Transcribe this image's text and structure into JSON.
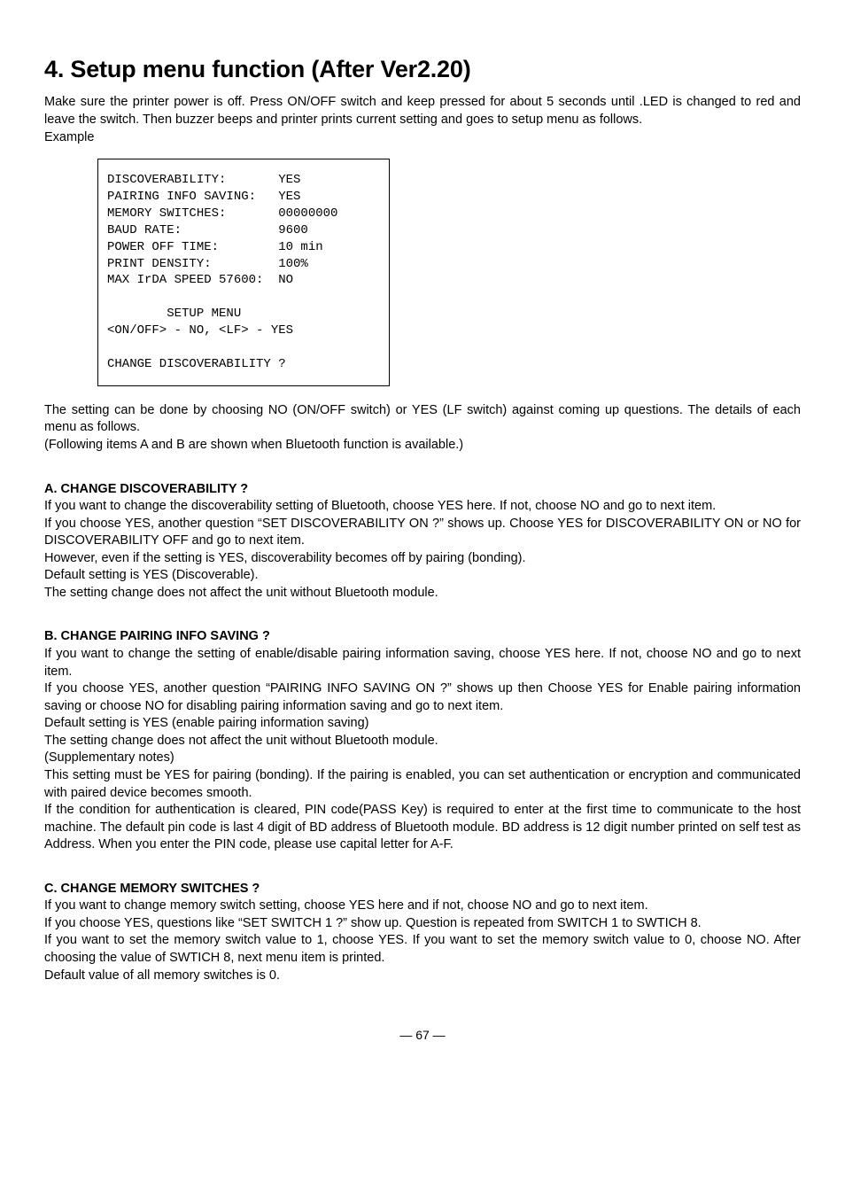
{
  "title": "4.  Setup menu function (After Ver2.20)",
  "intro": {
    "p1": "Make sure the printer power is off. Press ON/OFF switch and keep pressed for about 5 seconds until .LED is changed to red and leave the switch. Then buzzer beeps and printer prints current setting and goes to setup menu as follows.",
    "p2": "Example"
  },
  "example": "DISCOVERABILITY:       YES\nPAIRING INFO SAVING:   YES\nMEMORY SWITCHES:       00000000\nBAUD RATE:             9600\nPOWER OFF TIME:        10 min\nPRINT DENSITY:         100%\nMAX IrDA SPEED 57600:  NO\n\n        SETUP MENU\n<ON/OFF> - NO, <LF> - YES\n\nCHANGE DISCOVERABILITY ?",
  "after_example": {
    "p1": "The setting can be done by choosing NO (ON/OFF switch) or YES (LF switch) against coming up questions. The details of each menu as follows.",
    "p2": "(Following items A and B are shown when Bluetooth function is available.)"
  },
  "sectA": {
    "head": "A. CHANGE DISCOVERABILITY ?",
    "p1": "If you want to change the discoverability setting of Bluetooth, choose YES here. If not, choose NO and go to next item.",
    "p2": "If you choose YES, another question “SET DISCOVERABILITY ON ?” shows up. Choose YES for DISCOVERABILITY ON or NO for DISCOVERABILITY OFF and go to next item.",
    "p3": "However, even if the setting is YES, discoverability becomes off by pairing (bonding).",
    "p4": "Default setting is YES (Discoverable).",
    "p5": "The setting change does not affect the unit without Bluetooth module."
  },
  "sectB": {
    "head": "B. CHANGE PAIRING INFO SAVING ?",
    "p1": "If you want to change the setting of enable/disable pairing information saving, choose YES here. If not, choose NO and go to next item.",
    "p2": "If you choose YES, another question “PAIRING INFO SAVING ON ?” shows up then Choose YES for Enable pairing information saving or choose NO for disabling pairing information saving and go to next item.",
    "p3": "Default setting is YES (enable pairing information saving)",
    "p4": "The setting change does not affect the unit without Bluetooth module.",
    "p5": "(Supplementary notes)",
    "p6": "This setting must be YES for pairing (bonding). If the pairing is enabled, you can set authentication or encryption and communicated with paired device becomes smooth.",
    "p7": "If the condition for authentication is cleared, PIN code(PASS Key) is required to enter at the first time to communicate to the host machine. The default pin code is last 4 digit of BD address of Bluetooth module. BD address is 12 digit number printed on self test as Address. When you enter the PIN code, please use capital letter for A-F."
  },
  "sectC": {
    "head": "C. CHANGE MEMORY SWITCHES ?",
    "p1": "If you want to change memory switch setting, choose YES here and if not, choose NO and go to next item.",
    "p2": "If you choose YES, questions like “SET SWITCH 1 ?” show up. Question is repeated from SWITCH 1 to SWTICH 8.",
    "p3": "If you want to set the memory switch value to 1, choose YES. If you want to set the memory switch value to 0, choose NO. After choosing the value of SWTICH 8, next menu item is printed.",
    "p4": "Default value of all memory switches is 0."
  },
  "page_number": "— 67 —"
}
